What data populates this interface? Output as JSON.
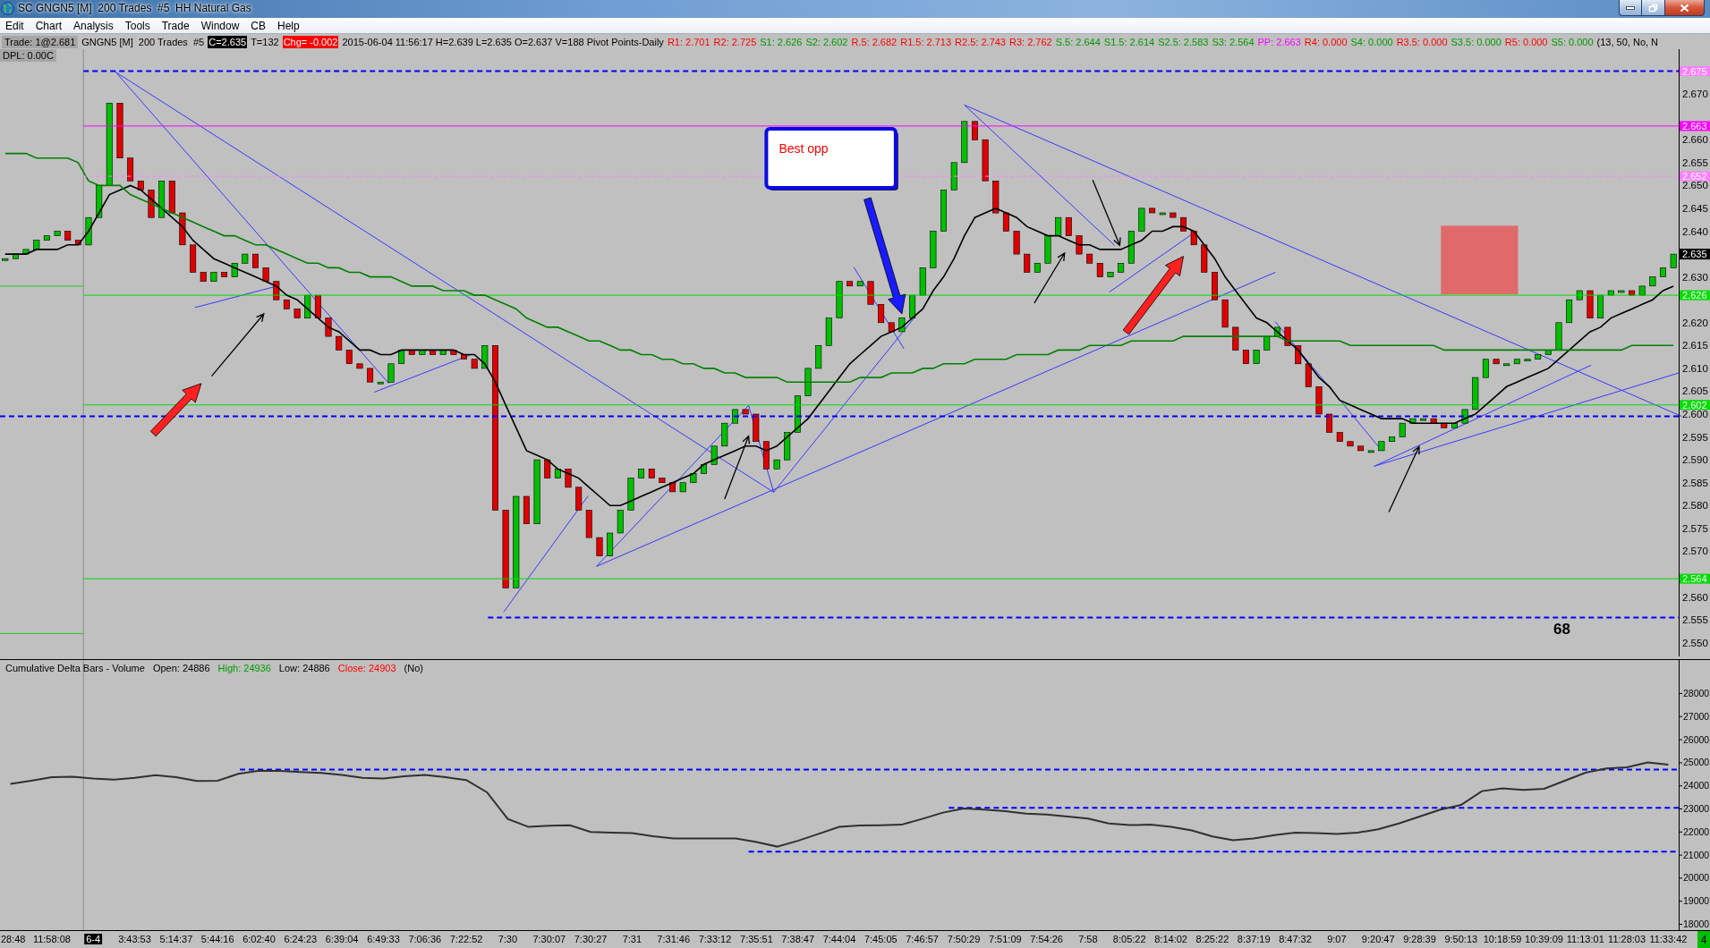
{
  "window": {
    "title": "SC GNGN5 [M]  200 Trades  #5  HH Natural Gas"
  },
  "menu": [
    "Edit",
    "Chart",
    "Analysis",
    "Tools",
    "Trade",
    "Window",
    "CB",
    "Help"
  ],
  "info_bar": {
    "items": [
      {
        "kind": "boxed",
        "text": "Trade: 1@2.681"
      },
      {
        "kind": "plain",
        "text": "GNGN5 [M]  200 Trades  #5"
      },
      {
        "kind": "inverse",
        "text": "C=2.635"
      },
      {
        "kind": "plain",
        "text": "T=132"
      },
      {
        "kind": "alert",
        "text": "Chg= -0.002"
      },
      {
        "kind": "plain",
        "text": "2015-06-04 11:56:17 H=2.639 L=2.635 O=2.637 V=188 Pivot Points-Daily"
      },
      {
        "kind": "value",
        "text": "R1: 2.701",
        "color": "#ff0000"
      },
      {
        "kind": "value",
        "text": "R2: 2.725",
        "color": "#ff0000"
      },
      {
        "kind": "value",
        "text": "S1: 2.626",
        "color": "#009900"
      },
      {
        "kind": "value",
        "text": "S2: 2.602",
        "color": "#009900"
      },
      {
        "kind": "value",
        "text": "R.5: 2.682",
        "color": "#ff0000"
      },
      {
        "kind": "value",
        "text": "R1.5: 2.713",
        "color": "#ff0000"
      },
      {
        "kind": "value",
        "text": "R2.5: 2.743",
        "color": "#ff0000"
      },
      {
        "kind": "value",
        "text": "R3: 2.762",
        "color": "#ff0000"
      },
      {
        "kind": "value",
        "text": "S.5: 2.644",
        "color": "#009900"
      },
      {
        "kind": "value",
        "text": "S1.5: 2.614",
        "color": "#009900"
      },
      {
        "kind": "value",
        "text": "S2.5: 2.583",
        "color": "#009900"
      },
      {
        "kind": "value",
        "text": "S3: 2.564",
        "color": "#009900"
      },
      {
        "kind": "value",
        "text": "PP: 2.663",
        "color": "#ff00ff"
      },
      {
        "kind": "value",
        "text": "R4: 0.000",
        "color": "#ff0000"
      },
      {
        "kind": "value",
        "text": "S4: 0.000",
        "color": "#009900"
      },
      {
        "kind": "value",
        "text": "R3.5: 0.000",
        "color": "#ff0000"
      },
      {
        "kind": "value",
        "text": "S3.5: 0.000",
        "color": "#009900"
      },
      {
        "kind": "value",
        "text": "R5: 0.000",
        "color": "#ff0000"
      },
      {
        "kind": "value",
        "text": "S5: 0.000",
        "color": "#009900"
      },
      {
        "kind": "plain",
        "text": "(13, 50, No, N"
      }
    ]
  },
  "price_panel": {
    "status_text": "DPL: 0.00C",
    "chart_data": {
      "type": "line",
      "ylim": [
        2.547,
        2.6798
      ],
      "categories": [
        null,
        null,
        null,
        null,
        null,
        null,
        null,
        null,
        null,
        null,
        null,
        null,
        null,
        null,
        null,
        null,
        null,
        null,
        null,
        null,
        null,
        null,
        null,
        null,
        null,
        null,
        null,
        null,
        null,
        null,
        null,
        null,
        null,
        null,
        null,
        null,
        null,
        null,
        null,
        null,
        null,
        null,
        null,
        null,
        null,
        null,
        null,
        null,
        null,
        null,
        null,
        null,
        null,
        null,
        null,
        null,
        null,
        null,
        null,
        null,
        null,
        null,
        null,
        null,
        null,
        null,
        null,
        null,
        null,
        null,
        null,
        null,
        null,
        null,
        null,
        null,
        null,
        null,
        null,
        null,
        null,
        null,
        null,
        null,
        null,
        null,
        null,
        null,
        null,
        null,
        null,
        null,
        null,
        null,
        null,
        null,
        null,
        null,
        null,
        null,
        null,
        null,
        null,
        null,
        null,
        null,
        null,
        null,
        null,
        null,
        null,
        null,
        null,
        null,
        null,
        null,
        null,
        null,
        null,
        null,
        null,
        null,
        null,
        null,
        null,
        null,
        null,
        null,
        null,
        null,
        null,
        null,
        null,
        null,
        null,
        null,
        null,
        null,
        null,
        null,
        null,
        null,
        null,
        null,
        null,
        null,
        null,
        null,
        null,
        null,
        null,
        null,
        null
      ],
      "yticks": [
        {
          "value": 2.67,
          "label": "2.670"
        },
        {
          "value": 2.66,
          "label": "2.660"
        },
        {
          "value": 2.655,
          "label": "2.655"
        },
        {
          "value": 2.65,
          "label": "2.650"
        },
        {
          "value": 2.645,
          "label": "2.645"
        },
        {
          "value": 2.64,
          "label": "2.640"
        },
        {
          "value": 2.635,
          "label": "2.635"
        },
        {
          "value": 2.63,
          "label": "2.630"
        },
        {
          "value": 2.62,
          "label": "2.620"
        },
        {
          "value": 2.615,
          "label": "2.615"
        },
        {
          "value": 2.61,
          "label": "2.610"
        },
        {
          "value": 2.605,
          "label": "2.605"
        },
        {
          "value": 2.6,
          "label": "2.600"
        },
        {
          "value": 2.595,
          "label": "2.595"
        },
        {
          "value": 2.59,
          "label": "2.590"
        },
        {
          "value": 2.585,
          "label": "2.585"
        },
        {
          "value": 2.58,
          "label": "2.580"
        },
        {
          "value": 2.575,
          "label": "2.575"
        },
        {
          "value": 2.57,
          "label": "2.570"
        },
        {
          "value": 2.56,
          "label": "2.560"
        },
        {
          "value": 2.555,
          "label": "2.555"
        },
        {
          "value": 2.55,
          "label": "2.550"
        }
      ],
      "series": [
        {
          "color": "#000000",
          "values": [
            2.64,
            2.644,
            2.648,
            2.649,
            2.65,
            2.649,
            2.647,
            2.645,
            2.643,
            2.641,
            2.638,
            2.636,
            2.634,
            2.633,
            2.632,
            2.631,
            2.63,
            2.629,
            2.628,
            2.626,
            2.625,
            2.623,
            2.621,
            2.619,
            2.618,
            2.616,
            2.614,
            2.614,
            2.613,
            2.613,
            2.614,
            2.614,
            2.614,
            2.614,
            2.614,
            2.614,
            2.613,
            2.613,
            2.611,
            2.607,
            2.602,
            2.597,
            2.592,
            2.591,
            2.59,
            2.588,
            2.587,
            2.586,
            2.584,
            2.582,
            2.58,
            2.58,
            2.581,
            2.582,
            2.583,
            2.584,
            2.585,
            2.586,
            2.587,
            2.589,
            2.59,
            2.591,
            2.592,
            2.593,
            2.593,
            2.592,
            2.593,
            2.595,
            2.597,
            2.599,
            2.602,
            2.605,
            2.608,
            2.611,
            2.613,
            2.615,
            2.617,
            2.618,
            2.619,
            2.621,
            2.623,
            2.627,
            2.63,
            2.634,
            2.639,
            2.643,
            2.644,
            2.645,
            2.644,
            2.643,
            2.641,
            2.64,
            2.639,
            2.639,
            2.638,
            2.637,
            2.637,
            2.636,
            2.636,
            2.636,
            2.637,
            2.638,
            2.64,
            2.64,
            2.641,
            2.641,
            2.64,
            2.637,
            2.634,
            2.63,
            2.627,
            2.624,
            2.621,
            2.62,
            2.618,
            2.616,
            2.614,
            2.611,
            2.608,
            2.606,
            2.603,
            2.602,
            2.601,
            2.6,
            2.599,
            2.599,
            2.599,
            2.598,
            2.598,
            2.598,
            2.598,
            2.598,
            2.599,
            2.6,
            2.602,
            2.604,
            2.606,
            2.607,
            2.608,
            2.609,
            2.61,
            2.612,
            2.614,
            2.616,
            2.618,
            2.619,
            2.621,
            2.622,
            2.623,
            2.624,
            2.625,
            2.627,
            2.628
          ]
        },
        {
          "color": "#008000",
          "values": [
            2.651,
            2.65,
            2.65,
            2.65,
            2.648,
            2.647,
            2.646,
            2.645,
            2.644,
            2.643,
            2.642,
            2.641,
            2.64,
            2.639,
            2.639,
            2.638,
            2.637,
            2.637,
            2.636,
            2.635,
            2.634,
            2.633,
            2.633,
            2.632,
            2.632,
            2.631,
            2.631,
            2.63,
            2.63,
            2.63,
            2.629,
            2.628,
            2.628,
            2.628,
            2.627,
            2.627,
            2.627,
            2.626,
            2.626,
            2.625,
            2.624,
            2.623,
            2.621,
            2.62,
            2.619,
            2.619,
            2.618,
            2.617,
            2.616,
            2.616,
            2.615,
            2.614,
            2.614,
            2.613,
            2.613,
            2.612,
            2.612,
            2.611,
            2.611,
            2.61,
            2.61,
            2.609,
            2.609,
            2.608,
            2.608,
            2.608,
            2.608,
            2.607,
            2.607,
            2.607,
            2.607,
            2.607,
            2.607,
            2.607,
            2.608,
            2.608,
            2.608,
            2.609,
            2.609,
            2.609,
            2.61,
            2.61,
            2.611,
            2.611,
            2.611,
            2.612,
            2.612,
            2.612,
            2.612,
            2.613,
            2.613,
            2.613,
            2.613,
            2.614,
            2.614,
            2.614,
            2.615,
            2.615,
            2.615,
            2.615,
            2.616,
            2.616,
            2.616,
            2.616,
            2.616,
            2.617,
            2.617,
            2.617,
            2.617,
            2.617,
            2.617,
            2.617,
            2.617,
            2.617,
            2.617,
            2.616,
            2.616,
            2.616,
            2.616,
            2.616,
            2.616,
            2.615,
            2.615,
            2.615,
            2.615,
            2.615,
            2.615,
            2.615,
            2.615,
            2.615,
            2.614,
            2.614,
            2.614,
            2.614,
            2.614,
            2.614,
            2.614,
            2.614,
            2.614,
            2.614,
            2.614,
            2.614,
            2.614,
            2.614,
            2.614,
            2.614,
            2.614,
            2.614,
            2.615,
            2.615,
            2.615,
            2.615,
            2.615
          ]
        }
      ],
      "ref_lines": [
        {
          "axis": "y",
          "value": 2.675,
          "label": "2.675",
          "color": "#0000ff"
        },
        {
          "axis": "y",
          "value": 2.663,
          "label": "2.663",
          "color": "#ff00ff"
        },
        {
          "axis": "y",
          "value": 2.652,
          "label": "2.652",
          "color": "#ff80ff"
        },
        {
          "axis": "y",
          "value": 2.626,
          "label": "2.626",
          "color": "#00dd00"
        },
        {
          "axis": "y",
          "value": 2.602,
          "label": "2.602",
          "color": "#00dd00"
        },
        {
          "axis": "y",
          "value": 2.5995,
          "color": "#0000ff"
        },
        {
          "axis": "y",
          "value": 2.564,
          "label": "2.564",
          "color": "#00dd00"
        },
        {
          "axis": "y",
          "value": 2.5555,
          "color": "#0000ff"
        }
      ],
      "annotations": [
        "Best opp",
        "68"
      ]
    }
  },
  "delta_panel": {
    "header": [
      {
        "text": "Cumulative Delta Bars - Volume"
      },
      {
        "text": "Open: 24886"
      },
      {
        "text": "High: 24936",
        "color": "#009900"
      },
      {
        "text": "Low: 24886"
      },
      {
        "text": "Close: 24903",
        "color": "#ff0000"
      },
      {
        "text": "(No)"
      }
    ],
    "corner_badge": "4",
    "chart_data": {
      "type": "line",
      "ylim": [
        17730,
        29470
      ],
      "yticks": [
        28000,
        27000,
        26000,
        25000,
        24000,
        23000,
        22000,
        21000,
        20000,
        19000,
        18000
      ],
      "categories": [
        "28:48",
        null,
        "11:58:08",
        null,
        "6-4",
        null,
        "3:43:53",
        null,
        "5:14:37",
        null,
        "5:44:16",
        null,
        "6:02:40",
        null,
        "6:24:23",
        null,
        "6:39:04",
        null,
        "6:49:33",
        null,
        "7:06:36",
        null,
        "7:22:52",
        null,
        "7:30",
        null,
        "7:30:07",
        null,
        "7:30:27",
        null,
        "7:31",
        null,
        "7:31:46",
        null,
        "7:33:12",
        null,
        "7:35:51",
        null,
        "7:38:47",
        null,
        "7:44:04",
        null,
        "7:45:05",
        null,
        "7:46:57",
        null,
        "7:50:29",
        null,
        "7:51:09",
        null,
        "7:54:26",
        null,
        "7:58",
        null,
        "8:05:22",
        null,
        "8:14:02",
        null,
        "8:25:22",
        null,
        "8:37:19",
        null,
        "8:47:32",
        null,
        "9:07",
        null,
        "9:20:47",
        null,
        "9:28:39",
        null,
        "9:50:13",
        null,
        "10:18:59",
        null,
        "10:39:09",
        null,
        "11:13:01",
        null,
        "11:28:03",
        null,
        "11:33:42"
      ],
      "values": [
        24070,
        24200,
        24350,
        24380,
        24300,
        24250,
        24330,
        24440,
        24350,
        24190,
        24200,
        24500,
        24640,
        24630,
        24580,
        24540,
        24450,
        24330,
        24300,
        24400,
        24450,
        24350,
        24230,
        23700,
        22550,
        22200,
        22250,
        22270,
        21980,
        21950,
        21930,
        21800,
        21700,
        21700,
        21700,
        21700,
        21550,
        21350,
        21600,
        21900,
        22200,
        22260,
        22270,
        22300,
        22550,
        22820,
        23000,
        22950,
        22880,
        22780,
        22740,
        22650,
        22560,
        22350,
        22280,
        22300,
        22200,
        22050,
        21790,
        21620,
        21700,
        21850,
        21950,
        21930,
        21900,
        21950,
        22100,
        22350,
        22650,
        22950,
        23150,
        23750,
        23870,
        23800,
        23850,
        24200,
        24550,
        24730,
        24780,
        24990,
        24900
      ],
      "ref_lines": [
        {
          "axis": "y",
          "value": 24680,
          "color": "#0000ff"
        },
        {
          "axis": "y",
          "value": 23030,
          "color": "#0000ff"
        },
        {
          "axis": "y",
          "value": 21130,
          "color": "#0000ff"
        }
      ]
    }
  }
}
